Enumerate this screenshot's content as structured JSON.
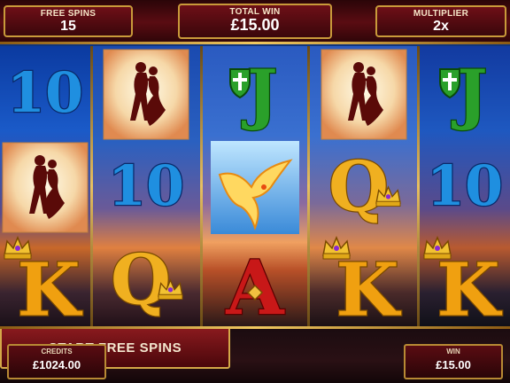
{
  "header": {
    "free_spins_label": "FREE SPINS",
    "free_spins_value": "15",
    "total_win_label": "TOTAL WIN",
    "total_win_value": "£15.00",
    "multiplier_label": "MULTIPLIER",
    "multiplier_value": "2x"
  },
  "reels": [
    {
      "symbols": [
        "10",
        "couple",
        "K"
      ]
    },
    {
      "symbols": [
        "couple",
        "10",
        "Q"
      ]
    },
    {
      "symbols": [
        "J",
        "phoenix",
        "A"
      ]
    },
    {
      "symbols": [
        "couple",
        "Q",
        "K"
      ]
    },
    {
      "symbols": [
        "J",
        "10",
        "K"
      ]
    }
  ],
  "footer": {
    "credits_label": "CREDITS",
    "credits_value": "£1024.00",
    "start_button_label": "START FREE SPINS",
    "win_label": "WIN",
    "win_value": "£15.00"
  },
  "colors": {
    "panel_red": "#5a0c12",
    "gold_trim": "#d4a848",
    "ten_blue": "#1f8fe0",
    "jack_green": "#2aa02a",
    "queen_gold": "#f0b020",
    "king_gold": "#f0a010",
    "ace_red": "#c81818"
  },
  "icons": {
    "couple": "dancing-couple-icon",
    "phoenix": "phoenix-bird-icon",
    "crown": "crown-icon",
    "shield": "shield-icon"
  }
}
